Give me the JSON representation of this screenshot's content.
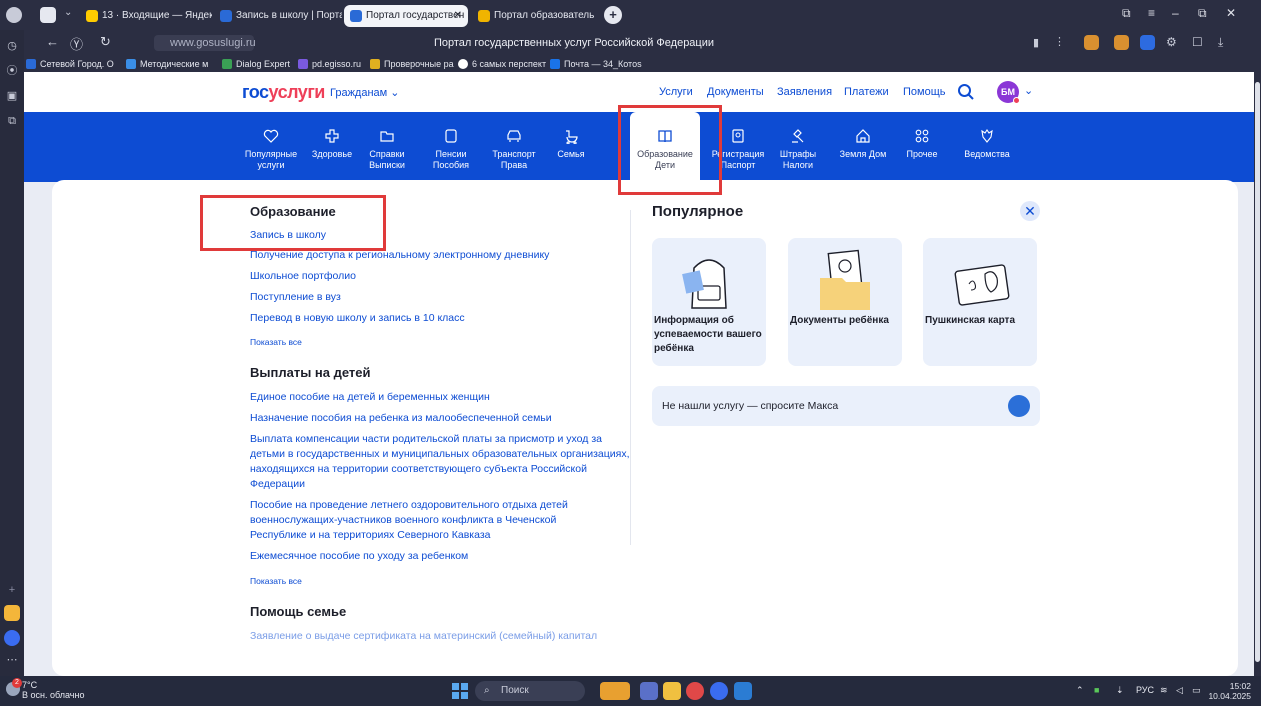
{
  "browser": {
    "tabs": [
      {
        "label": "13 · Входящие — Яндекс",
        "favicon_color": "#ffcc00"
      },
      {
        "label": "Запись в школу | Портал",
        "favicon_color": "#2a6ad6"
      },
      {
        "label": "Портал государствен",
        "favicon_color": "#2a6ad6",
        "active": true
      },
      {
        "label": "Портал образователь",
        "favicon_color": "#f0b400"
      }
    ],
    "url": "www.gosuslugi.ru",
    "page_title": "Портал государственных услуг Российской Федерации",
    "bookmarks": [
      {
        "label": "Сетевой Город. О",
        "color": "#2a6ad6"
      },
      {
        "label": "Методические м",
        "color": "#3a8ee6"
      },
      {
        "label": "Dialog Expert",
        "color": "#3aa055"
      },
      {
        "label": "pd.egisso.ru",
        "color": "#7a5ae0"
      },
      {
        "label": "Проверочные ра",
        "color": "#e0b020"
      },
      {
        "label": "6 самых перспект",
        "color": "#ffffff"
      },
      {
        "label": "Почта — 34_Котоs",
        "color": "#1a73e8"
      }
    ]
  },
  "site": {
    "logo_part1": "гос",
    "logo_part2": "услуги",
    "audience": "Гражданам",
    "nav": [
      "Услуги",
      "Документы",
      "Заявления",
      "Платежи",
      "Помощь"
    ],
    "avatar_initials": "БМ",
    "categories": [
      {
        "l1": "Популярные",
        "l2": "услуги",
        "icon": "heart-icon"
      },
      {
        "l1": "Здоровье",
        "l2": "",
        "icon": "medical-cross-icon"
      },
      {
        "l1": "Справки",
        "l2": "Выписки",
        "icon": "folder-icon"
      },
      {
        "l1": "Пенсии",
        "l2": "Пособия",
        "icon": "wallet-icon"
      },
      {
        "l1": "Транспорт",
        "l2": "Права",
        "icon": "car-icon"
      },
      {
        "l1": "Семья",
        "l2": "",
        "icon": "stroller-icon"
      },
      {
        "l1": "Образование",
        "l2": "Дети",
        "icon": "book-icon"
      },
      {
        "l1": "Регистрация",
        "l2": "Паспорт",
        "icon": "id-card-icon"
      },
      {
        "l1": "Штрафы",
        "l2": "Налоги",
        "icon": "gavel-icon"
      },
      {
        "l1": "Земля Дом",
        "l2": "",
        "icon": "house-icon"
      },
      {
        "l1": "Прочее",
        "l2": "",
        "icon": "grid-icon"
      },
      {
        "l1": "Ведомства",
        "l2": "",
        "icon": "emblem-icon"
      }
    ]
  },
  "menu": {
    "education": {
      "title": "Образование",
      "links": [
        "Запись в школу",
        "Получение доступа к региональному электронному дневнику",
        "Школьное портфолио",
        "Поступление в вуз",
        "Перевод в новую школу и запись в 10 класс"
      ],
      "show_all": "Показать все"
    },
    "payments": {
      "title": "Выплаты на детей",
      "links": [
        "Единое пособие на детей и беременных женщин",
        "Назначение пособия на ребенка из малообеспеченной семьи",
        "Выплата компенсации части родительской платы за присмотр и уход за детьми в государственных и муниципальных образовательных организациях, находящихся на территории соответствующего субъекта Российской Федерации",
        "Пособие на проведение летнего оздоровительного отдыха детей военнослужащих-участников военного конфликта в Чеченской Республике и на территориях Северного Кавказа",
        "Ежемесячное пособие по уходу за ребенком"
      ],
      "show_all": "Показать все"
    },
    "family_help": {
      "title": "Помощь семье",
      "links": [
        "Заявление о выдаче сертификата на материнский (семейный) капитал"
      ]
    }
  },
  "popular": {
    "title": "Популярное",
    "cards": [
      "Информация об успеваемости вашего ребёнка",
      "Документы ребёнка",
      "Пушкинская карта"
    ],
    "ask": "Не нашли услугу — спросите Макса"
  },
  "taskbar": {
    "temp": "7°C",
    "weather": "В осн. облачно",
    "badge": "2",
    "search": "Поиск",
    "lang": "РУС",
    "time": "15:02",
    "date": "10.04.2025"
  },
  "colors": {
    "brand_blue": "#0d4cd3",
    "brand_red": "#ee3f58",
    "highlight": "#e03a3a"
  }
}
